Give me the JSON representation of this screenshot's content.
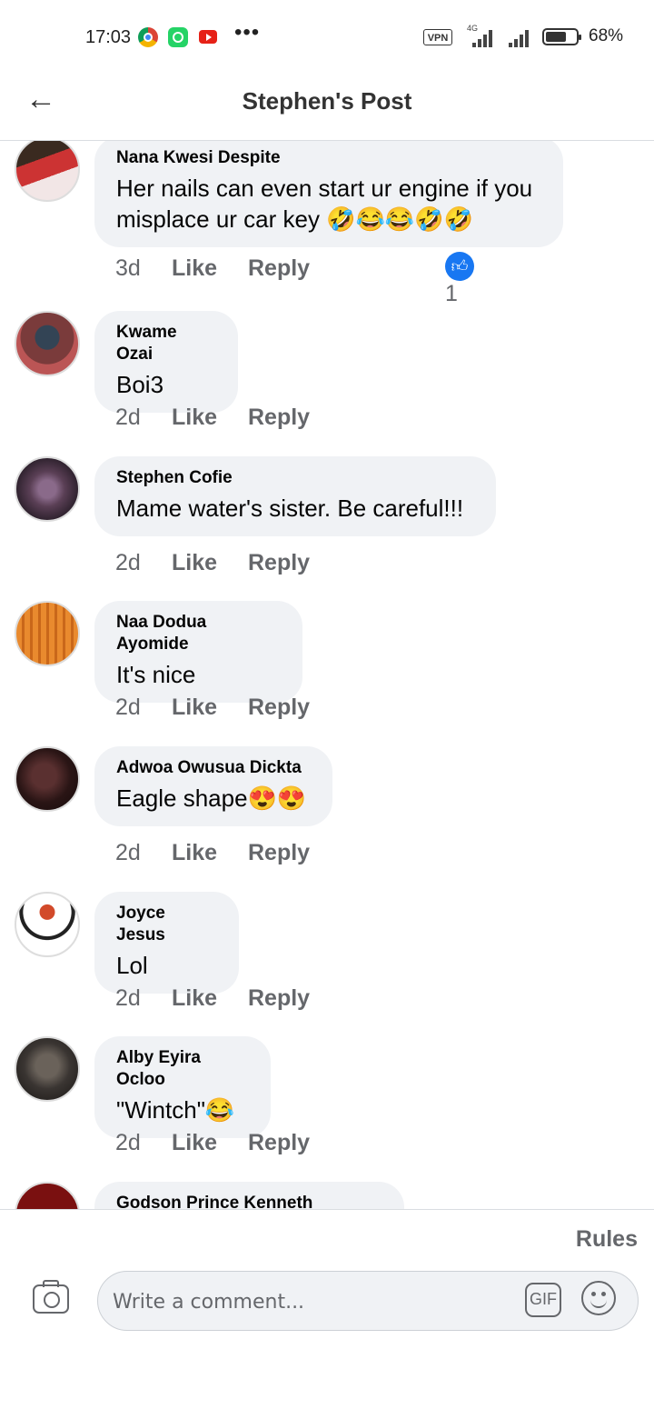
{
  "status_bar": {
    "time": "17:03",
    "vpn": "VPN",
    "network": "4G",
    "battery_pct": "68%",
    "battery_level": 0.68,
    "app_icons": [
      "chrome-icon",
      "whatsapp-icon",
      "youtube-icon"
    ]
  },
  "header": {
    "title": "Stephen's Post"
  },
  "comments": [
    {
      "author": "Nana Kwesi Despite",
      "text": "Her nails can even start ur engine if you misplace ur car key 🤣😂😂🤣🤣",
      "ago": "3d",
      "like": "Like",
      "reply": "Reply",
      "reaction_count": "1"
    },
    {
      "author": "Kwame Ozai",
      "text": "Boi3",
      "ago": "2d",
      "like": "Like",
      "reply": "Reply"
    },
    {
      "author": "Stephen Cofie",
      "text": "Mame water's sister. Be careful!!!",
      "ago": "2d",
      "like": "Like",
      "reply": "Reply"
    },
    {
      "author": "Naa Dodua Ayomide",
      "text": "It's nice",
      "ago": "2d",
      "like": "Like",
      "reply": "Reply"
    },
    {
      "author": "Adwoa Owusua Dickta",
      "text": "Eagle shape😍😍",
      "ago": "2d",
      "like": "Like",
      "reply": "Reply"
    },
    {
      "author": "Joyce Jesus",
      "text": "Lol",
      "ago": "2d",
      "like": "Like",
      "reply": "Reply"
    },
    {
      "author": "Alby Eyira Ocloo",
      "text": "\"Wintch\"😂",
      "ago": "2d",
      "like": "Like",
      "reply": "Reply"
    },
    {
      "author": "Godson Prince Kenneth",
      "text": ""
    }
  ],
  "footer": {
    "rules": "Rules",
    "placeholder": "Write a comment...",
    "gif": "GIF"
  },
  "colors": {
    "bubble": "#f0f2f5",
    "secondary_text": "#65676b",
    "like_blue": "#1877f2"
  }
}
